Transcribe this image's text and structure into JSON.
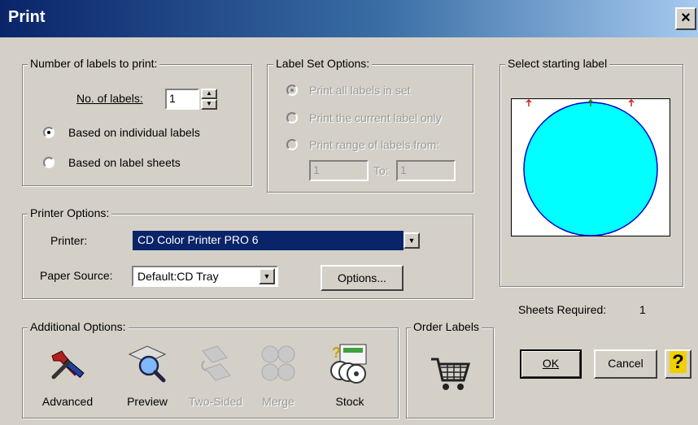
{
  "window": {
    "title": "Print",
    "close_glyph": "×"
  },
  "labels_group": {
    "legend": "Number of labels to print:",
    "count_label": "No. of labels:",
    "count_value": "1",
    "option_individual": "Based on individual labels",
    "option_sheets": "Based on label sheets",
    "selected": "individual"
  },
  "label_set_group": {
    "legend": "Label Set Options:",
    "option_all": "Print all labels in set",
    "option_current": "Print the current label only",
    "option_range": "Print range of labels from:",
    "range_from": "1",
    "range_to_label": "To:",
    "range_to": "1",
    "enabled": false
  },
  "printer_group": {
    "legend": "Printer Options:",
    "printer_label": "Printer:",
    "printer_value": "CD Color Printer PRO 6",
    "paper_label": "Paper Source:",
    "paper_value": "Default:CD Tray",
    "options_button": "Options..."
  },
  "start_label_group": {
    "legend": "Select starting label",
    "sheets_label": "Sheets Required:",
    "sheets_value": "1",
    "label_fill_color": "#00ffff"
  },
  "additional_group": {
    "legend": "Additional Options:",
    "tools": [
      {
        "label": "Advanced",
        "icon": "tools-icon",
        "enabled": true
      },
      {
        "label": "Preview",
        "icon": "magnifier-icon",
        "enabled": true
      },
      {
        "label": "Two-Sided",
        "icon": "two-sided-icon",
        "enabled": false
      },
      {
        "label": "Merge",
        "icon": "merge-icon",
        "enabled": false
      },
      {
        "label": "Stock",
        "icon": "stock-icon",
        "enabled": true
      }
    ]
  },
  "order_group": {
    "legend": "Order Labels",
    "icon": "cart-icon"
  },
  "buttons": {
    "ok": "OK",
    "cancel": "Cancel",
    "help_glyph": "?"
  }
}
